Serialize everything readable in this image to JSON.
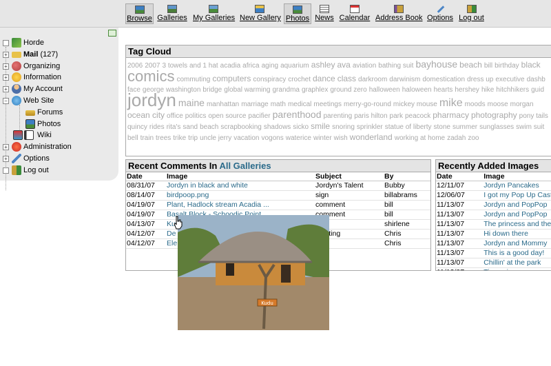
{
  "toolbar": {
    "items": [
      {
        "label": "Browse",
        "icon": "browse-icon",
        "active": true
      },
      {
        "label": "Galleries",
        "icon": "galleries-icon"
      },
      {
        "label": "My Galleries",
        "icon": "my-galleries-icon"
      },
      {
        "label": "New Gallery",
        "icon": "new-gallery-icon"
      },
      {
        "label": "Photos",
        "icon": "photos-icon",
        "active": true
      },
      {
        "label": "News",
        "icon": "news-icon"
      },
      {
        "label": "Calendar",
        "icon": "calendar-icon"
      },
      {
        "label": "Address Book",
        "icon": "address-book-icon"
      },
      {
        "label": "Options",
        "icon": "options-icon"
      },
      {
        "label": "Log out",
        "icon": "logout-icon"
      }
    ]
  },
  "sidebar": {
    "items": [
      {
        "label": "Horde",
        "icon": "horde-icon"
      },
      {
        "label": "Mail",
        "count": "(127)",
        "icon": "mail-icon"
      },
      {
        "label": "Organizing",
        "icon": "organizing-icon"
      },
      {
        "label": "Information",
        "icon": "information-icon"
      },
      {
        "label": "My Account",
        "icon": "account-icon"
      },
      {
        "label": "Web Site",
        "icon": "website-icon"
      },
      {
        "label": "Forums",
        "icon": "forums-icon"
      },
      {
        "label": "Photos",
        "icon": "photos-icon"
      },
      {
        "label": "Wiki",
        "icon": "wiki-icon"
      },
      {
        "label": "Administration",
        "icon": "administration-icon"
      },
      {
        "label": "Options",
        "icon": "options-icon"
      },
      {
        "label": "Log out",
        "icon": "logout-icon"
      }
    ]
  },
  "tag_cloud": {
    "title": "Tag Cloud",
    "lines": [
      [
        [
          "2006",
          10
        ],
        [
          "2007",
          10
        ],
        [
          "3 towels and 1 hat",
          10
        ],
        [
          "acadia",
          10
        ],
        [
          "africa",
          10
        ],
        [
          "aging",
          10
        ],
        [
          "aquarium",
          10
        ],
        [
          "ashley",
          12
        ],
        [
          "ava",
          12
        ],
        [
          "aviation",
          10
        ],
        [
          "bathing suit",
          10
        ],
        [
          "bayhouse",
          14
        ],
        [
          "beach",
          12
        ],
        [
          "bill",
          10
        ],
        [
          "birthday",
          10
        ],
        [
          "black",
          12
        ]
      ],
      [
        [
          "comics",
          22
        ],
        [
          "commuting",
          10
        ],
        [
          "computers",
          12
        ],
        [
          "conspiracy",
          10
        ],
        [
          "crochet",
          10
        ],
        [
          "dance",
          12
        ],
        [
          "class",
          12
        ],
        [
          "darkroom",
          10
        ],
        [
          "darwinism",
          10
        ],
        [
          "domestication",
          10
        ],
        [
          "dress up",
          10
        ],
        [
          "executive",
          10
        ],
        [
          "dashb",
          10
        ]
      ],
      [
        [
          "face",
          10
        ],
        [
          "george washington",
          10
        ],
        [
          "bridge",
          10
        ],
        [
          "global warming",
          10
        ],
        [
          "grandma",
          10
        ],
        [
          "graphlex",
          10
        ],
        [
          "ground zero",
          10
        ],
        [
          "halloween",
          10
        ],
        [
          "haloween",
          10
        ],
        [
          "hearts",
          10
        ],
        [
          "hershey",
          10
        ],
        [
          "hike",
          10
        ],
        [
          "hitchhikers",
          10
        ],
        [
          "guid",
          10
        ]
      ],
      [
        [
          "jordyn",
          26
        ],
        [
          "maine",
          14
        ],
        [
          "manhattan",
          10
        ],
        [
          "marriage",
          10
        ],
        [
          "math",
          10
        ],
        [
          "medical",
          10
        ],
        [
          "meetings",
          10
        ],
        [
          "merry-go-round",
          10
        ],
        [
          "mickey mouse",
          10
        ],
        [
          "mike",
          16
        ],
        [
          "moods",
          10
        ],
        [
          "moose",
          10
        ],
        [
          "morgan",
          10
        ]
      ],
      [
        [
          "ocean city",
          12
        ],
        [
          "office",
          10
        ],
        [
          "politics",
          10
        ],
        [
          "open source",
          10
        ],
        [
          "pacifier",
          10
        ],
        [
          "parenthood",
          14
        ],
        [
          "parenting",
          10
        ],
        [
          "paris hilton",
          10
        ],
        [
          "park",
          10
        ],
        [
          "peacock",
          10
        ],
        [
          "pharmacy",
          12
        ],
        [
          "photography",
          12
        ],
        [
          "pony tails",
          10
        ]
      ],
      [
        [
          "quincy",
          10
        ],
        [
          "rides",
          10
        ],
        [
          "rita's",
          10
        ],
        [
          "sand",
          10
        ],
        [
          "beach",
          10
        ],
        [
          "scrapbooking",
          10
        ],
        [
          "shadows",
          10
        ],
        [
          "sicko",
          10
        ],
        [
          "smile",
          12
        ],
        [
          "snoring",
          10
        ],
        [
          "sprinkler",
          10
        ],
        [
          "statue of liberty",
          10
        ],
        [
          "stone",
          10
        ],
        [
          "summer",
          10
        ],
        [
          "sunglasses",
          10
        ],
        [
          "swim suit",
          10
        ]
      ],
      [
        [
          "bell",
          10
        ],
        [
          "train",
          10
        ],
        [
          "trees",
          10
        ],
        [
          "trike",
          10
        ],
        [
          "trip",
          10
        ],
        [
          "uncle jerry",
          10
        ],
        [
          "vacation",
          10
        ],
        [
          "vogons",
          10
        ],
        [
          "waterice",
          10
        ],
        [
          "winter",
          10
        ],
        [
          "wish",
          10
        ],
        [
          "wonderland",
          12
        ],
        [
          "working at home",
          10
        ],
        [
          "zadah",
          10
        ],
        [
          "zoo",
          10
        ]
      ]
    ]
  },
  "comments": {
    "title_prefix": "Recent Comments In ",
    "title_link": "All Galleries",
    "headers": [
      "Date",
      "Image",
      "Subject",
      "By"
    ],
    "rows": [
      [
        "08/31/07",
        "Jordyn in black and white",
        "Jordyn's Talent",
        "Bubby"
      ],
      [
        "08/14/07",
        "birdpoop.png",
        "sign",
        "billabrams"
      ],
      [
        "04/19/07",
        "Plant, Hadlock stream Acadia ...",
        "comment",
        "bill"
      ],
      [
        "04/19/07",
        "Basalt Block - Schoodic Point ...",
        "comment",
        "bill"
      ],
      [
        "04/13/07",
        "Ku",
        "l pic",
        "shirlene"
      ],
      [
        "04/12/07",
        "De",
        "l setting",
        "Chris"
      ],
      [
        "04/12/07",
        "Ele",
        "",
        "Chris"
      ]
    ]
  },
  "recently_added": {
    "title": "Recently Added Images",
    "headers": [
      "Date",
      "Image"
    ],
    "rows": [
      [
        "12/11/07",
        "Jordyn Pancakes"
      ],
      [
        "12/06/07",
        "I got my Pop Up Cast"
      ],
      [
        "11/13/07",
        "Jordyn and PopPop"
      ],
      [
        "11/13/07",
        "Jordyn and PopPop"
      ],
      [
        "11/13/07",
        "The princess and the"
      ],
      [
        "11/13/07",
        "Hi down there"
      ],
      [
        "11/13/07",
        "Jordyn and Mommy"
      ],
      [
        "11/13/07",
        "This is a good day!"
      ],
      [
        "11/13/07",
        "Chillin' at the park"
      ],
      [
        "11/13/07",
        "Tire swing"
      ]
    ]
  },
  "preview": {
    "sign_text": "Kudu",
    "colors": {
      "sky": "#9bb3c8",
      "thatch": "#9a8f84",
      "wall": "#c98a3c",
      "ground": "#a2896a",
      "tree": "#5f7d3a"
    }
  },
  "colors": {
    "link": "#2a6a8a",
    "tag": "#a9a9a9",
    "toolbar": "#e6e6e6",
    "sidebar": "#eaeaea"
  }
}
